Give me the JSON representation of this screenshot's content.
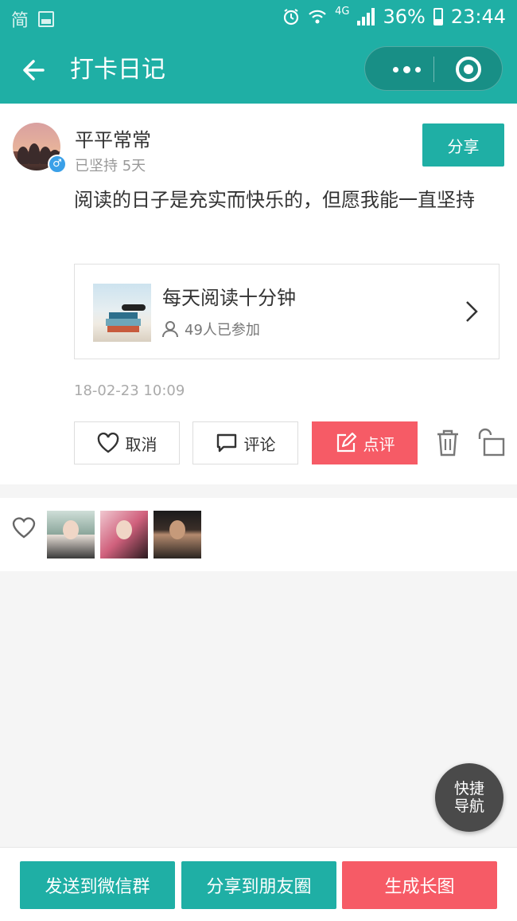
{
  "status_bar": {
    "left_char": "简",
    "network": "4G",
    "battery": "36%",
    "time": "23:44"
  },
  "navbar": {
    "title": "打卡日记"
  },
  "post": {
    "username": "平平常常",
    "streak": "已坚持 5天",
    "share_label": "分享",
    "text": "阅读的日子是充实而快乐的，但愿我能一直坚持",
    "challenge": {
      "title": "每天阅读十分钟",
      "members": "49人已参加"
    },
    "time": "18-02-23 10:09",
    "actions": {
      "cancel_label": "取消",
      "comment_label": "评论",
      "review_label": "点评"
    }
  },
  "likes": {
    "count_avatars": 3
  },
  "fab": {
    "line1": "快捷",
    "line2": "导航"
  },
  "bottom": {
    "send_group": "发送到微信群",
    "share_moments": "分享到朋友圈",
    "generate_image": "生成长图"
  },
  "colors": {
    "primary": "#1fafa5",
    "accent_red": "#f65b66"
  }
}
